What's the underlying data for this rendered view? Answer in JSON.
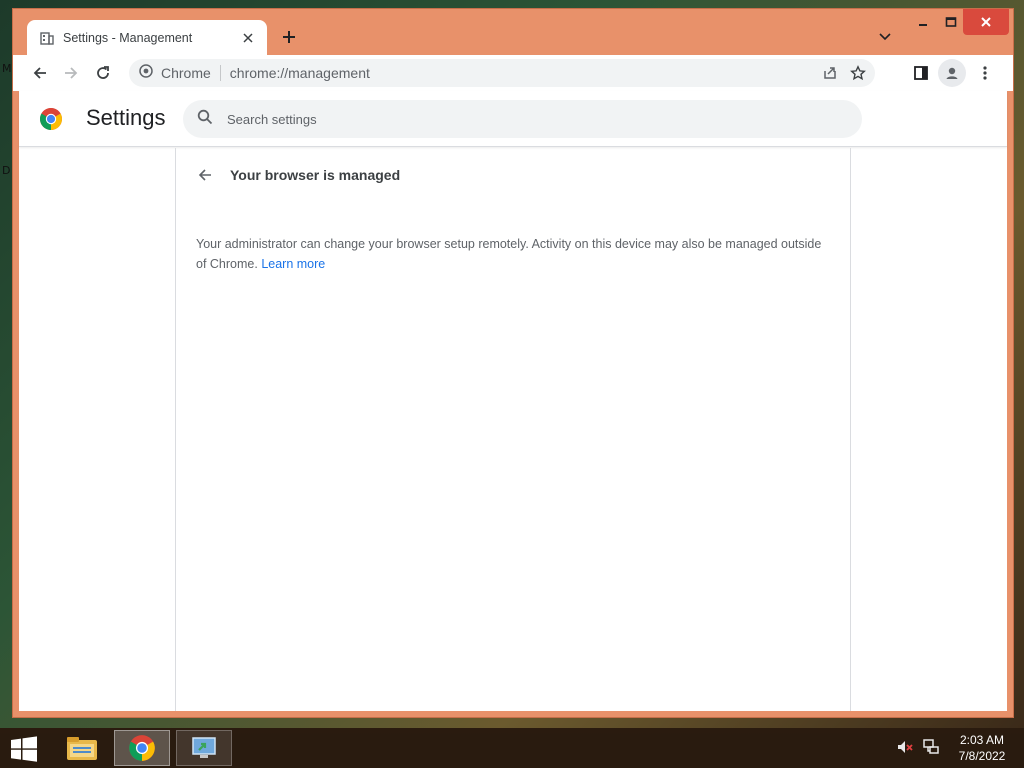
{
  "desktop": {
    "letters": [
      "M",
      "D"
    ]
  },
  "window": {
    "tab": {
      "title": "Settings - Management"
    },
    "controls": {
      "minimize": "–",
      "maximize": "□",
      "close": "✕"
    }
  },
  "toolbar": {
    "omnibox": {
      "site_name": "Chrome",
      "url": "chrome://management"
    }
  },
  "settings": {
    "title": "Settings",
    "search_placeholder": "Search settings"
  },
  "management": {
    "page_title": "Your browser is managed",
    "description": "Your administrator can change your browser setup remotely. Activity on this device may also be managed outside of Chrome.",
    "learn_more": "Learn more"
  },
  "taskbar": {
    "apps": [
      "explorer",
      "chrome",
      "remote-desktop"
    ],
    "time": "2:03 AM",
    "date": "7/8/2022"
  },
  "icons": {
    "tab_favicon": "building-icon",
    "back": "arrow-left-icon",
    "forward": "arrow-right-icon",
    "reload": "reload-icon",
    "share": "share-icon",
    "bookmark": "star-icon",
    "side_panel": "side-panel-icon",
    "profile": "profile-icon",
    "menu": "kebab-menu-icon",
    "search": "search-icon"
  },
  "colors": {
    "frame": "#e8916a",
    "link": "#1a73e8",
    "close_button": "#d94a3d"
  }
}
